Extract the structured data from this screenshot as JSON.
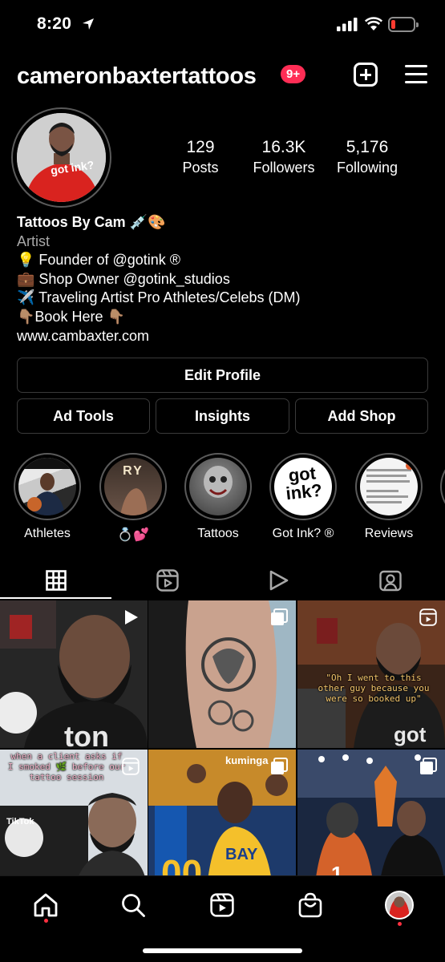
{
  "status_bar": {
    "time": "8:20"
  },
  "header": {
    "username": "cameronbaxtertattoos",
    "notification_badge": "9+"
  },
  "profile": {
    "stats": [
      {
        "value": "129",
        "label": "Posts"
      },
      {
        "value": "16.3K",
        "label": "Followers"
      },
      {
        "value": "5,176",
        "label": "Following"
      }
    ],
    "avatar_shirt_text": "got ink?",
    "bio": {
      "name": "Tattoos By Cam 💉🎨",
      "category": "Artist",
      "lines": [
        "💡 Founder of @gotink ®",
        "💼 Shop Owner @gotink_studios",
        "✈️ Traveling Artist Pro Athletes/Celebs (DM)",
        "👇🏽Book Here 👇🏽"
      ],
      "link": "www.cambaxter.com"
    }
  },
  "buttons": {
    "edit_profile": "Edit Profile",
    "ad_tools": "Ad Tools",
    "insights": "Insights",
    "add_shop": "Add Shop"
  },
  "highlights": [
    {
      "label": "Athletes"
    },
    {
      "label": "💍💕"
    },
    {
      "label": "Tattoos"
    },
    {
      "label": "Got Ink? ®"
    },
    {
      "label": "Reviews"
    }
  ],
  "highlight_texts": {
    "ry": "RY",
    "gotink": "got ink?"
  },
  "tabs": [
    {
      "name": "grid",
      "icon": "grid-icon",
      "active": true
    },
    {
      "name": "reels",
      "icon": "reels-icon",
      "active": false
    },
    {
      "name": "videos",
      "icon": "play-icon",
      "active": false
    },
    {
      "name": "tagged",
      "icon": "tagged-icon",
      "active": false
    }
  ],
  "grid_posts": {
    "post3_caption": "\"Oh I went to this other guy because you were so booked up\"",
    "post4_caption": "when a client asks if I smoked 🌿 before our tattoo session",
    "post4_watermark": "TikTok",
    "post5_name": "kuminga",
    "post5_jersey": "BAY",
    "post6_jersey": "1"
  },
  "colors": {
    "accent_badge": "#ff2d55",
    "notification_dot": "#ff3040",
    "background": "#000000"
  }
}
